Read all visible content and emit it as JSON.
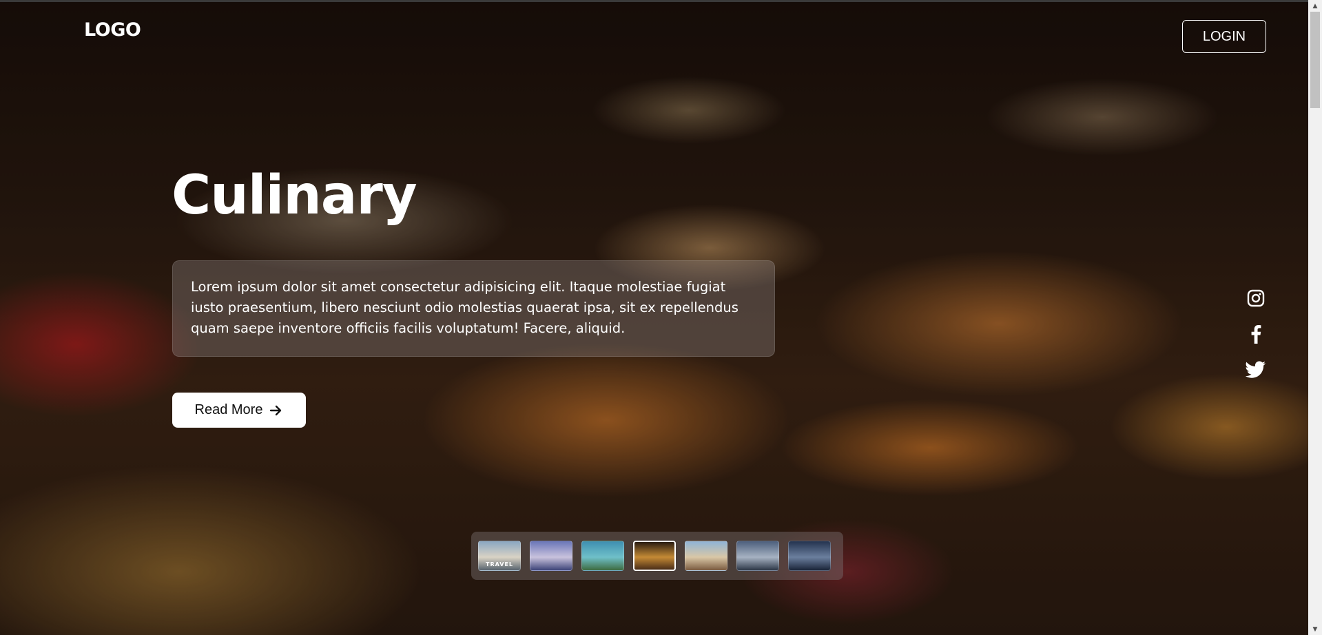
{
  "header": {
    "logo_text": "LOGO",
    "login_label": "LOGIN"
  },
  "hero": {
    "title": "Culinary",
    "description": "Lorem ipsum dolor sit amet consectetur adipisicing elit. Itaque molestiae fugiat iusto praesentium, libero nesciunt odio molestias quaerat ipsa, sit ex repellendus quam saepe inventore officiis facilis voluptatum! Facere, aliquid.",
    "read_more_label": "Read More",
    "read_more_icon": "arrow-right-icon"
  },
  "social": [
    {
      "name": "instagram",
      "icon": "instagram-icon"
    },
    {
      "name": "facebook",
      "icon": "facebook-icon"
    },
    {
      "name": "twitter",
      "icon": "twitter-icon"
    }
  ],
  "thumbnails": [
    {
      "label": "TRAVEL",
      "active": false,
      "colors": [
        "#8aa7c2",
        "#d9d3c5",
        "#57636e"
      ]
    },
    {
      "label": "",
      "active": false,
      "colors": [
        "#6a76b8",
        "#c9c2dd",
        "#3c4378"
      ]
    },
    {
      "label": "",
      "active": false,
      "colors": [
        "#3f8fb0",
        "#6fc0c9",
        "#3d6b3f"
      ]
    },
    {
      "label": "",
      "active": true,
      "colors": [
        "#2a1c12",
        "#c58a35",
        "#4a2d18"
      ]
    },
    {
      "label": "",
      "active": false,
      "colors": [
        "#8fb3d6",
        "#d9c7a6",
        "#7a5a3f"
      ]
    },
    {
      "label": "",
      "active": false,
      "colors": [
        "#4c5f7d",
        "#a6b2c2",
        "#2c3646"
      ]
    },
    {
      "label": "",
      "active": false,
      "colors": [
        "#24334f",
        "#6b7f9e",
        "#1a2438"
      ]
    }
  ],
  "colors": {
    "text": "#ffffff",
    "button_bg": "#ffffff",
    "button_text": "#111111"
  }
}
